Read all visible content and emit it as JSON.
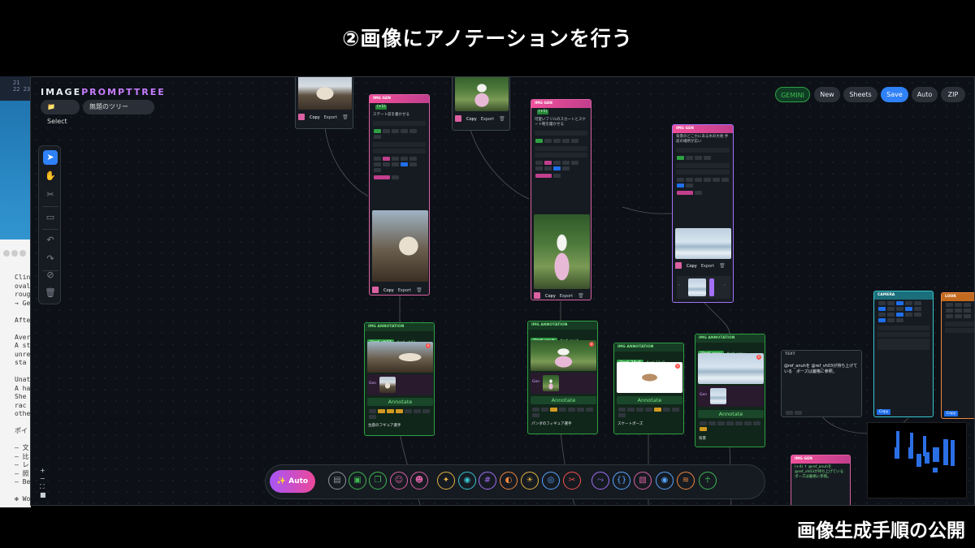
{
  "slide": {
    "title": "②画像にアノテーションを行う",
    "caption": "画像生成手順の公開"
  },
  "background": {
    "terminal_lines": [
      "Clin",
      "oval",
      "roug",
      "→ Ge",
      "",
      "Afte",
      "",
      "Aver",
      "A st",
      "unre",
      " sta",
      "",
      "Unat",
      "A ha",
      " She",
      " rac",
      "othe",
      "",
      "ポイ",
      "",
      "– 文",
      "– 比",
      "– レ",
      "– 照",
      "– Be",
      "",
      "✻ Work"
    ],
    "mini_header": [
      "21",
      "22  23"
    ]
  },
  "app": {
    "brand_left": "IMAGE",
    "brand_right": "PROMPTTREE",
    "select_label": "📁Select",
    "tree_name": "無題のツリー",
    "top_buttons": {
      "gemini": "GEMINI",
      "new": "New",
      "sheets": "Sheets",
      "save": "Save",
      "auto": "Auto",
      "zip": "ZIP"
    },
    "tools": [
      "cursor-icon",
      "hand-icon",
      "scissors-icon",
      "comment-icon",
      "undo-icon",
      "redo-icon",
      "link-off-icon",
      "trash-icon"
    ],
    "zoom": {
      "plus": "+",
      "minus": "−",
      "fit": "⛶",
      "lock": "🔒"
    },
    "nodes": {
      "gen1": {
        "head": "IMG GEN",
        "badge": "(+1)",
        "text": "ステート前を書かせる",
        "copy": "Copy",
        "export": "Export"
      },
      "gen2": {
        "head": "IMG GEN",
        "badge": "(+1)",
        "text": "可愛いフリルのスカートとスケート靴を履かせる",
        "copy": "Copy",
        "export": "Export"
      },
      "gen3": {
        "head": "IMG GEN",
        "text": "背景のどこかにある水の大地 手前の場所が広い",
        "copy": "Copy",
        "export": "Export"
      },
      "top1": {
        "copy": "Copy",
        "export": "Export"
      },
      "top2": {
        "copy": "Copy",
        "export": "Export"
      },
      "ann1": {
        "head": "IMG ANNOTATION",
        "tag": "@ref_vh03",
        "ref": "#ref_vh03",
        "gen": "Gen",
        "annotate": "Annotate",
        "note": "台座のフギュア選手"
      },
      "ann2": {
        "head": "IMG ANNOTATION",
        "tag": "@ref_anuh",
        "ref": "#ref_anuh",
        "gen": "Gen",
        "annotate": "Annotate",
        "note": "パンダのフィギュア選手"
      },
      "ann3": {
        "head": "IMG ANNOTATION",
        "tag": "@ref_23y9",
        "ref": "#ref_23y9",
        "annotate": "Annotate",
        "note": "スケートポーズ"
      },
      "ann4": {
        "head": "IMG ANNOTATION",
        "tag": "@ref_xcav",
        "ref": "#ref_xcav",
        "gen": "Gen",
        "annotate": "Annotate",
        "note": "背景"
      },
      "text1": {
        "head": "TEXT",
        "body": "@ref_anuhを @ref_vh03が持ち上げている　ポーズは厳格に参照。"
      },
      "camera": {
        "head": "CAMERA",
        "copy": "Copy"
      },
      "look": {
        "head": "LOOK",
        "copy": "Copy"
      },
      "gen4": {
        "head": "IMG GEN",
        "text": "(+4) ↑ @ref_anuhを @ref_vh03が持ち上げている　ポーズは厳格に参照。"
      }
    },
    "toolbar": {
      "auto": "Auto",
      "icons": [
        "document-icon",
        "image-icon",
        "images-icon",
        "person-icon",
        "face-icon",
        "sparkle-icon",
        "camera-icon",
        "grid-icon",
        "palette-icon",
        "sun-icon",
        "compass-icon",
        "scissors-icon",
        "route-icon",
        "braces-icon",
        "picture-edit-icon",
        "eye-icon",
        "layers-icon",
        "figure-icon"
      ],
      "colors": [
        "#8b949e",
        "#3fb950",
        "#3fb950",
        "#db61a2",
        "#db61a2",
        "#e3b341",
        "#39c5cf",
        "#a371f7",
        "#f0883e",
        "#e3b341",
        "#58a6ff",
        "#f85149",
        "#a371f7",
        "#58a6ff",
        "#db61a2",
        "#58a6ff",
        "#f0883e",
        "#3fb950"
      ]
    }
  }
}
